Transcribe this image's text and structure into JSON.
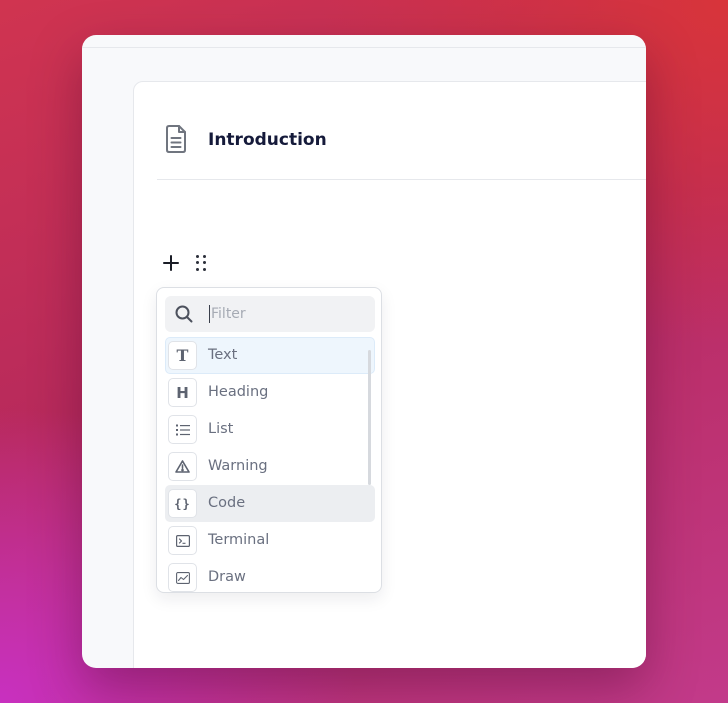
{
  "document": {
    "title": "Introduction",
    "icon": "document-icon"
  },
  "block_controls": {
    "add_icon": "plus-icon",
    "drag_icon": "drag-handle-icon"
  },
  "menu": {
    "filter": {
      "placeholder": "Filter",
      "value": "",
      "icon": "search-icon"
    },
    "items": [
      {
        "label": "Text",
        "icon": "text-icon",
        "state": "active"
      },
      {
        "label": "Heading",
        "icon": "heading-icon",
        "state": ""
      },
      {
        "label": "List",
        "icon": "list-icon",
        "state": ""
      },
      {
        "label": "Warning",
        "icon": "warning-icon",
        "state": ""
      },
      {
        "label": "Code",
        "icon": "code-icon",
        "state": "hover"
      },
      {
        "label": "Terminal",
        "icon": "terminal-icon",
        "state": ""
      },
      {
        "label": "Draw",
        "icon": "draw-icon",
        "state": ""
      }
    ]
  },
  "colors": {
    "title": "#151a3a",
    "item_label": "#6a7080",
    "active_bg": "#eef6fd",
    "hover_bg": "#eceef1"
  }
}
